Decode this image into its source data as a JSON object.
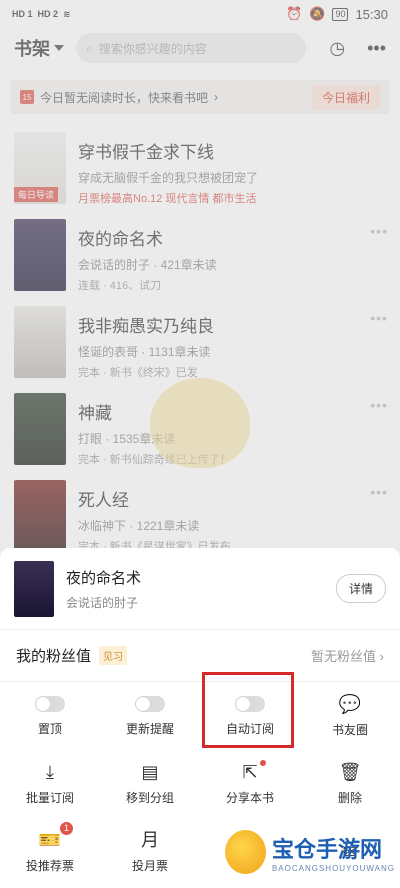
{
  "status": {
    "time": "15:30",
    "battery": "90",
    "signal_1": "HD 1",
    "signal_2": "HD 2"
  },
  "topbar": {
    "title": "书架",
    "search_placeholder": "搜索你感兴趣的内容"
  },
  "banner": {
    "text": "今日暂无阅读时长，快来看书吧",
    "welfare": "今日福利",
    "calendar_day": "15"
  },
  "books": [
    {
      "title": "穿书假千金求下线",
      "sub": "穿成无脑假千金的我只想被团宠了",
      "meta": "月票榜最高No.12   现代言情   都市生活",
      "badge": "每日导读"
    },
    {
      "title": "夜的命名术",
      "sub": "会说话的肘子 · 421章未读",
      "meta": "连载 · 416、试刀"
    },
    {
      "title": "我非痴愚实乃纯良",
      "sub": "怪诞的表哥 · 1131章未读",
      "meta": "完本 · 新书《终宋》已发"
    },
    {
      "title": "神藏",
      "sub": "打眼 · 1535章未读",
      "meta": "完本 · 新书仙踪奇缘已上传了！"
    },
    {
      "title": "死人经",
      "sub": "冰临神下 · 1221章未读",
      "meta": "完本 · 新书《星谋世家》已发布"
    }
  ],
  "sheet": {
    "book_title": "夜的命名术",
    "author": "会说话的肘子",
    "detail": "详情",
    "fan_label": "我的粉丝值",
    "fan_badge": "见习",
    "fan_value": "暂无粉丝值",
    "toggles": [
      {
        "label": "置顶",
        "on": false
      },
      {
        "label": "更新提醒",
        "on": false
      },
      {
        "label": "自动订阅",
        "on": false
      },
      {
        "label": "书友圈",
        "icon": "chat-icon"
      }
    ],
    "actions": [
      {
        "label": "批量订阅",
        "icon": "download-icon"
      },
      {
        "label": "移到分组",
        "icon": "folder-icon"
      },
      {
        "label": "分享本书",
        "icon": "share-icon"
      },
      {
        "label": "删除",
        "icon": "trash-icon"
      }
    ],
    "bottom": [
      {
        "label": "投推荐票",
        "icon": "ticket-icon",
        "count": "1"
      },
      {
        "label": "投月票",
        "icon": "month-ticket-icon"
      },
      {
        "label": "",
        "icon": "money-icon"
      },
      {
        "label": "",
        "icon": "gift-icon"
      }
    ]
  },
  "watermark": {
    "title": "宝仓手游网",
    "sub": "BAOCANGSHOUYOUWANG"
  }
}
